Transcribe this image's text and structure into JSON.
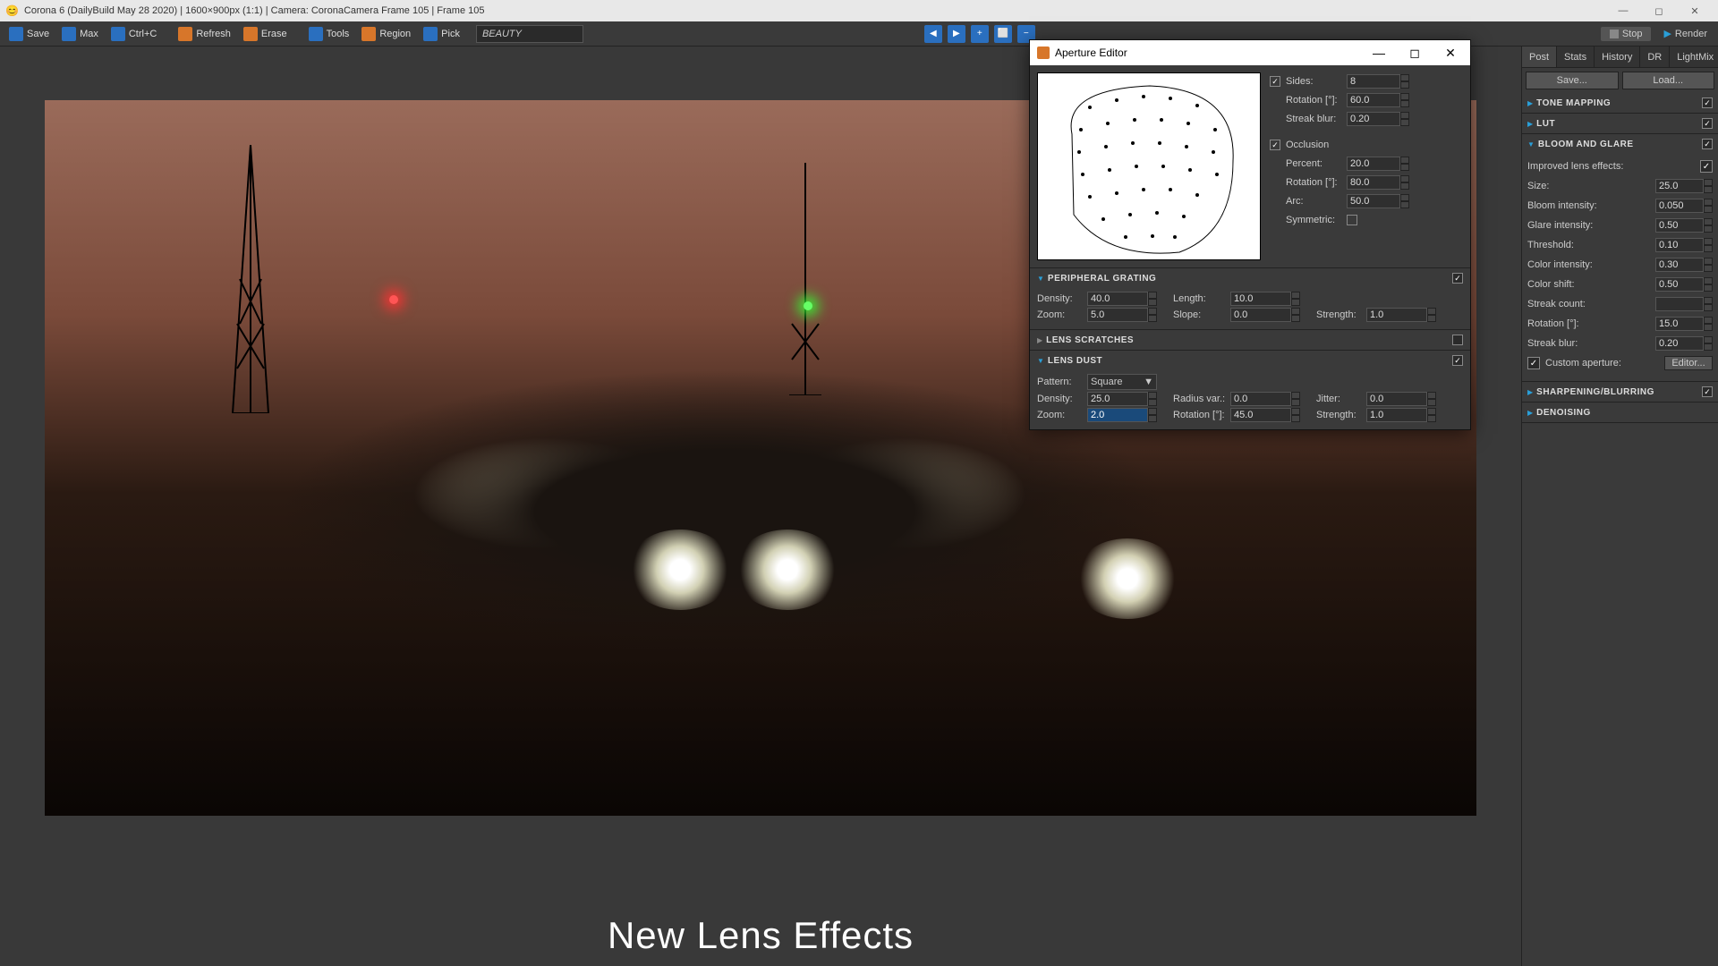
{
  "titlebar": {
    "text": "Corona 6 (DailyBuild May 28 2020) | 1600×900px (1:1) | Camera: CoronaCamera Frame 105 | Frame 105"
  },
  "toolbar": {
    "save": "Save",
    "max": "Max",
    "ctrlc": "Ctrl+C",
    "refresh": "Refresh",
    "erase": "Erase",
    "tools": "Tools",
    "region": "Region",
    "pick": "Pick",
    "dropdown": "BEAUTY",
    "stop": "Stop",
    "render": "Render"
  },
  "rightPanel": {
    "tabs": [
      "Post",
      "Stats",
      "History",
      "DR",
      "LightMix"
    ],
    "activeTab": "Post",
    "saveBtn": "Save...",
    "loadBtn": "Load...",
    "sections": {
      "tone": {
        "title": "TONE MAPPING"
      },
      "lut": {
        "title": "LUT"
      },
      "bloom": {
        "title": "BLOOM AND GLARE",
        "improved_label": "Improved lens effects:",
        "improved_checked": true,
        "size_label": "Size:",
        "size": "25.0",
        "bloom_label": "Bloom intensity:",
        "bloom": "0.050",
        "glare_label": "Glare intensity:",
        "glare": "0.50",
        "thresh_label": "Threshold:",
        "thresh": "0.10",
        "colint_label": "Color intensity:",
        "colint": "0.30",
        "colshift_label": "Color shift:",
        "colshift": "0.50",
        "streak_label": "Streak count:",
        "streak": "",
        "rot_label": "Rotation [°]:",
        "rot": "15.0",
        "blur_label": "Streak blur:",
        "blur": "0.20",
        "custom_label": "Custom aperture:",
        "custom_checked": true,
        "editor_btn": "Editor..."
      },
      "sharp": {
        "title": "SHARPENING/BLURRING"
      },
      "denoise": {
        "title": "DENOISING"
      }
    }
  },
  "dialog": {
    "title": "Aperture Editor",
    "sides_label": "Sides:",
    "sides_checked": true,
    "sides": "8",
    "rot_label": "Rotation [°]:",
    "rot": "60.0",
    "blur_label": "Streak blur:",
    "blur": "0.20",
    "occ_label": "Occlusion",
    "occ_checked": true,
    "pct_label": "Percent:",
    "pct": "20.0",
    "rot2_label": "Rotation [°]:",
    "rot2": "80.0",
    "arc_label": "Arc:",
    "arc": "50.0",
    "sym_label": "Symmetric:",
    "sym_checked": false,
    "grating": {
      "title": "PERIPHERAL GRATING",
      "checked": true,
      "density_label": "Density:",
      "density": "40.0",
      "length_label": "Length:",
      "length": "10.0",
      "zoom_label": "Zoom:",
      "zoom": "5.0",
      "slope_label": "Slope:",
      "slope": "0.0",
      "strength_label": "Strength:",
      "strength": "1.0"
    },
    "scratches": {
      "title": "LENS SCRATCHES",
      "checked": false
    },
    "dust": {
      "title": "LENS DUST",
      "checked": true,
      "pattern_label": "Pattern:",
      "pattern": "Square",
      "density_label": "Density:",
      "density": "25.0",
      "radvar_label": "Radius var.:",
      "radvar": "0.0",
      "jitter_label": "Jitter:",
      "jitter": "0.0",
      "zoom_label": "Zoom:",
      "zoom": "2.0",
      "rot_label": "Rotation [°]:",
      "rot": "45.0",
      "strength_label": "Strength:",
      "strength": "1.0"
    }
  },
  "caption": "New Lens Effects"
}
